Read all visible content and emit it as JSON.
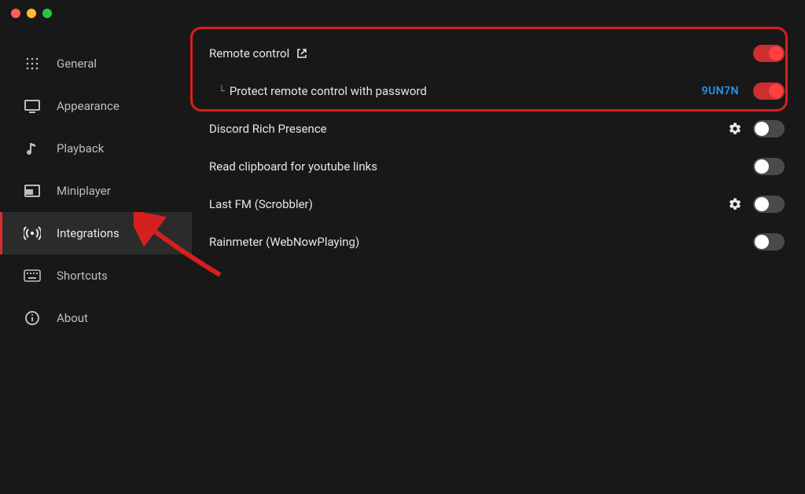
{
  "sidebar": {
    "items": [
      {
        "id": "general",
        "label": "General"
      },
      {
        "id": "appearance",
        "label": "Appearance"
      },
      {
        "id": "playback",
        "label": "Playback"
      },
      {
        "id": "miniplayer",
        "label": "Miniplayer"
      },
      {
        "id": "integrations",
        "label": "Integrations"
      },
      {
        "id": "shortcuts",
        "label": "Shortcuts"
      },
      {
        "id": "about",
        "label": "About"
      }
    ],
    "active": "integrations"
  },
  "integrations": {
    "remote_control": {
      "label": "Remote control",
      "enabled": true
    },
    "protect_password": {
      "label": "Protect remote control with password",
      "enabled": true,
      "code": "9UN7N"
    },
    "discord": {
      "label": "Discord Rich Presence",
      "enabled": false
    },
    "clipboard": {
      "label": "Read clipboard for youtube links",
      "enabled": false
    },
    "lastfm": {
      "label": "Last FM (Scrobbler)",
      "enabled": false
    },
    "rainmeter": {
      "label": "Rainmeter (WebNowPlaying)",
      "enabled": false
    }
  },
  "colors": {
    "accent": "#d6201f",
    "link": "#2d9bff"
  }
}
